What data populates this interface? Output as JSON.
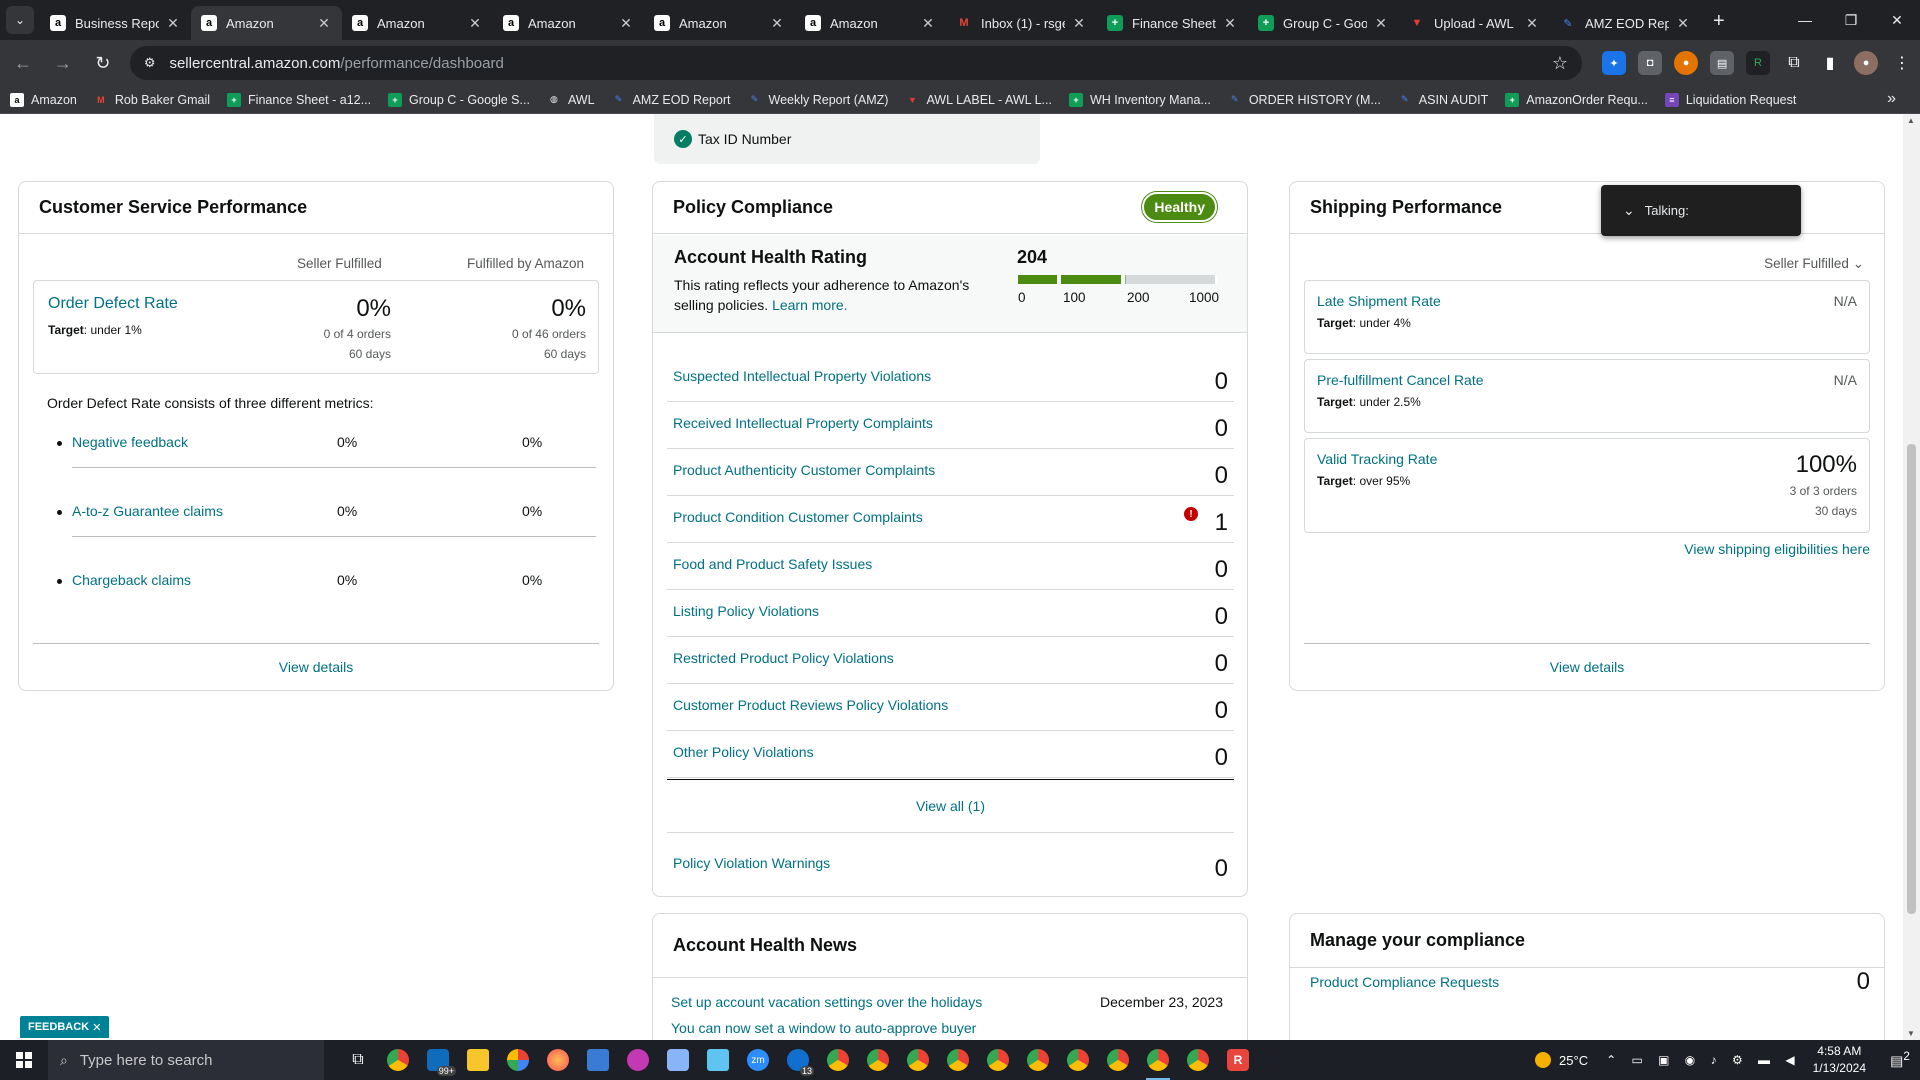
{
  "browser": {
    "tabs": [
      {
        "title": "Business Repor",
        "icon": "amazon-icon",
        "active": false
      },
      {
        "title": "Amazon",
        "icon": "amazon-icon",
        "active": true
      },
      {
        "title": "Amazon",
        "icon": "amazon-icon",
        "active": false
      },
      {
        "title": "Amazon",
        "icon": "amazon-icon",
        "active": false
      },
      {
        "title": "Amazon",
        "icon": "amazon-icon",
        "active": false
      },
      {
        "title": "Amazon",
        "icon": "amazon-icon",
        "active": false
      },
      {
        "title": "Inbox (1) - rsge",
        "icon": "gmail-icon",
        "active": false
      },
      {
        "title": "Finance Sheet",
        "icon": "sheets-icon",
        "active": false
      },
      {
        "title": "Group C - Goo",
        "icon": "sheets-icon",
        "active": false
      },
      {
        "title": "Upload - AWL I",
        "icon": "awl-icon",
        "active": false
      },
      {
        "title": "AMZ EOD Rep",
        "icon": "appsheet-icon",
        "active": false
      }
    ],
    "url_host": "sellercentral.amazon.com",
    "url_path": "/performance/dashboard",
    "bookmarks": [
      {
        "label": "Amazon",
        "icon": "amazon-icon"
      },
      {
        "label": "Rob Baker Gmail",
        "icon": "gmail-icon"
      },
      {
        "label": "Finance Sheet - a12...",
        "icon": "sheets-icon"
      },
      {
        "label": "Group C - Google S...",
        "icon": "sheets-icon"
      },
      {
        "label": "AWL",
        "icon": "globe-icon"
      },
      {
        "label": "AMZ EOD Report",
        "icon": "appsheet-icon"
      },
      {
        "label": "Weekly Report (AMZ)",
        "icon": "appsheet-icon"
      },
      {
        "label": "AWL LABEL - AWL L...",
        "icon": "awl-icon"
      },
      {
        "label": "WH Inventory Mana...",
        "icon": "sheets-icon"
      },
      {
        "label": "ORDER HISTORY (M...",
        "icon": "appsheet-icon"
      },
      {
        "label": "ASIN AUDIT",
        "icon": "appsheet-icon"
      },
      {
        "label": "AmazonOrder Requ...",
        "icon": "sheets-icon"
      },
      {
        "label": "Liquidation Request",
        "icon": "forms-icon"
      }
    ]
  },
  "tax_id": {
    "label": "Tax ID Number"
  },
  "customer_service": {
    "title": "Customer Service Performance",
    "col_seller": "Seller Fulfilled",
    "col_fba": "Fulfilled by Amazon",
    "odr": {
      "name": "Order Defect Rate",
      "target_label": "Target",
      "target_value": ": under 1%",
      "seller_pct": "0%",
      "seller_orders": "0 of 4 orders",
      "seller_days": "60 days",
      "fba_pct": "0%",
      "fba_orders": "0 of 46 orders",
      "fba_days": "60 days"
    },
    "note": "Order Defect Rate consists of three different metrics:",
    "metrics": [
      {
        "name": "Negative feedback",
        "seller": "0%",
        "fba": "0%"
      },
      {
        "name": "A-to-z Guarantee claims",
        "seller": "0%",
        "fba": "0%"
      },
      {
        "name": "Chargeback claims",
        "seller": "0%",
        "fba": "0%"
      }
    ],
    "view_details": "View details"
  },
  "policy": {
    "title": "Policy Compliance",
    "status": "Healthy",
    "ahr_title": "Account Health Rating",
    "ahr_desc": "This rating reflects your adherence to Amazon's selling policies.",
    "ahr_learn": "Learn more.",
    "ahr_score": "204",
    "ahr_score_value": 204,
    "ahr_ticks": [
      "0",
      "100",
      "200",
      "1000"
    ],
    "colors": {
      "green": "#4b8b11",
      "grey": "#d5d9d9"
    },
    "violations": [
      {
        "name": "Suspected Intellectual Property Violations",
        "count": "0",
        "alert": false
      },
      {
        "name": "Received Intellectual Property Complaints",
        "count": "0",
        "alert": false
      },
      {
        "name": "Product Authenticity Customer Complaints",
        "count": "0",
        "alert": false
      },
      {
        "name": "Product Condition Customer Complaints",
        "count": "1",
        "alert": true
      },
      {
        "name": "Food and Product Safety Issues",
        "count": "0",
        "alert": false
      },
      {
        "name": "Listing Policy Violations",
        "count": "0",
        "alert": false
      },
      {
        "name": "Restricted Product Policy Violations",
        "count": "0",
        "alert": false
      },
      {
        "name": "Customer Product Reviews Policy Violations",
        "count": "0",
        "alert": false
      },
      {
        "name": "Other Policy Violations",
        "count": "0",
        "alert": false
      }
    ],
    "view_all": "View all (1)",
    "warnings": {
      "name": "Policy Violation Warnings",
      "count": "0"
    }
  },
  "shipping": {
    "title": "Shipping Performance",
    "dropdown": "Seller Fulfilled",
    "metrics": [
      {
        "name": "Late Shipment Rate",
        "target_label": "Target",
        "target_value": ": under 4%",
        "value": "N/A"
      },
      {
        "name": "Pre-fulfillment Cancel Rate",
        "target_label": "Target",
        "target_value": ": under 2.5%",
        "value": "N/A"
      }
    ],
    "tracking": {
      "name": "Valid Tracking Rate",
      "target_label": "Target",
      "target_value": ": over 95%",
      "value": "100%",
      "orders": "3 of 3 orders",
      "days": "30 days"
    },
    "eligibilities": "View shipping eligibilities here",
    "view_details": "View details"
  },
  "talking": {
    "label": "Talking:"
  },
  "news": {
    "title": "Account Health News",
    "items": [
      {
        "text": "Set up account vacation settings over the holidays",
        "date": "December 23, 2023"
      },
      {
        "text": "You can now set a window to auto-approve buyer",
        "date": ""
      }
    ]
  },
  "manage": {
    "title": "Manage your compliance",
    "row": {
      "name": "Product Compliance Requests",
      "count": "0"
    }
  },
  "feedback": {
    "label": "FEEDBACK"
  },
  "taskbar": {
    "search_placeholder": "Type here to search",
    "temperature": "25°C",
    "time": "4:58 AM",
    "date": "1/13/2024",
    "mail_badge": "99+",
    "webex_badge": "13",
    "notifications": "2"
  }
}
